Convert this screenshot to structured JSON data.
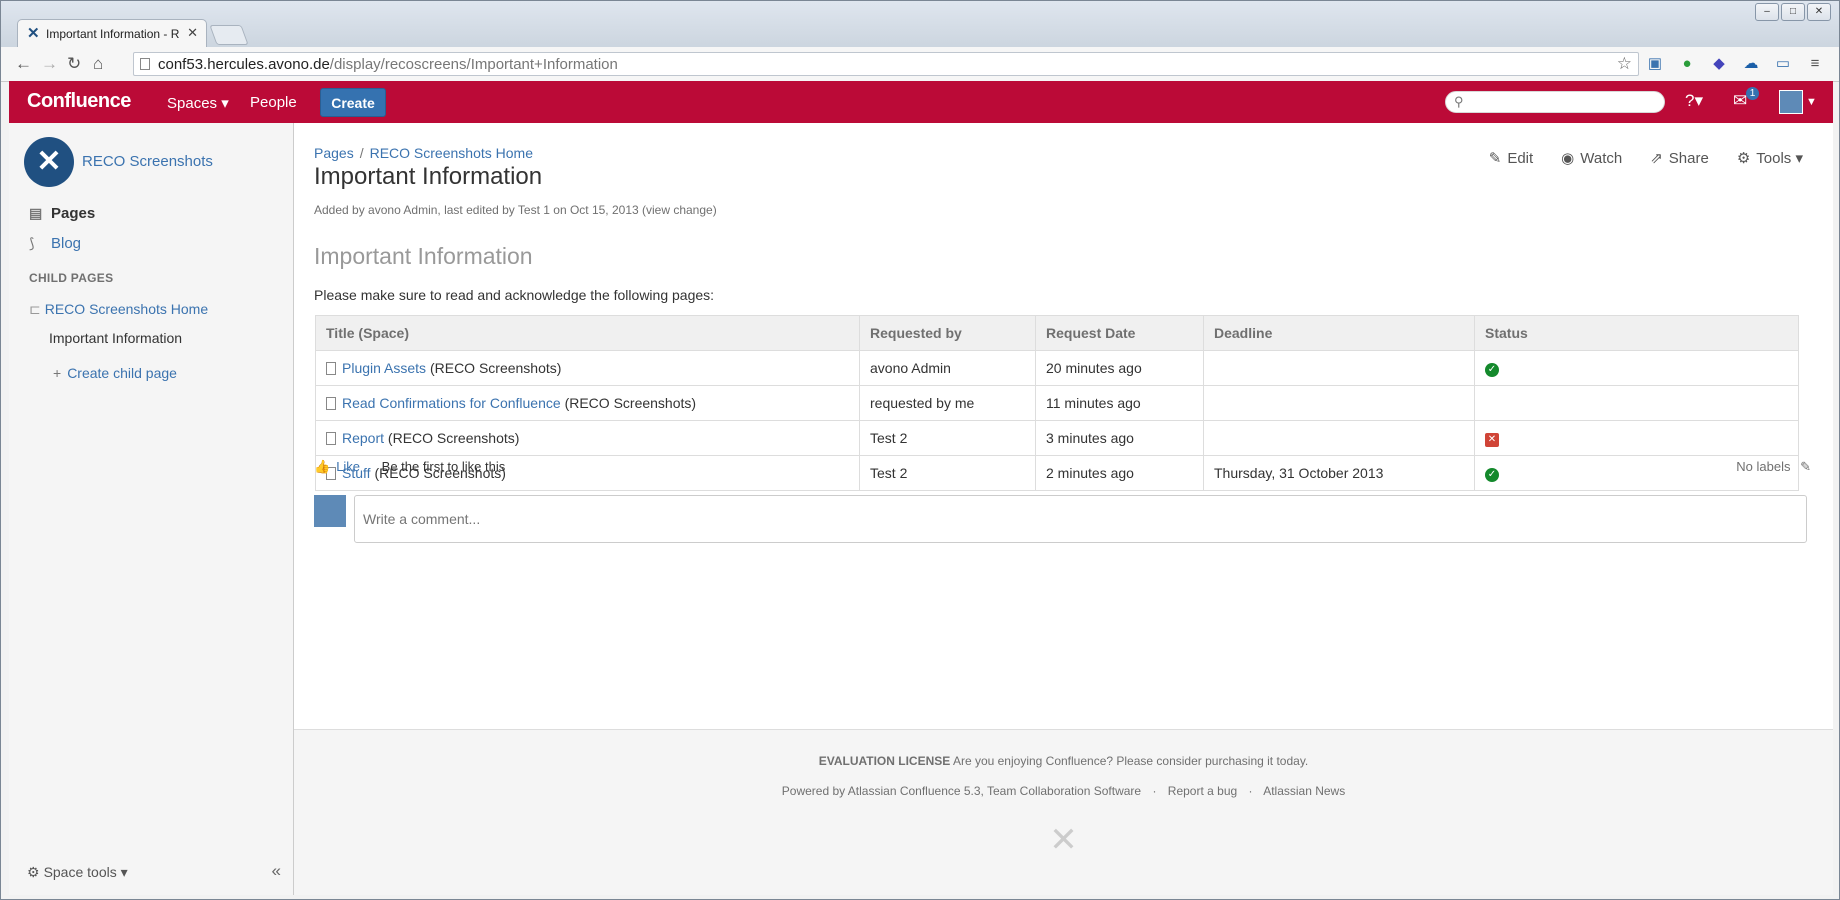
{
  "browser": {
    "tab_title": "Important Information - R",
    "url_host": "conf53.hercules.avono.de",
    "url_path": "/display/recoscreens/Important+Information"
  },
  "header": {
    "logo": "Confluence",
    "spaces_label": "Spaces ▾",
    "people_label": "People",
    "create_label": "Create",
    "notification_count": "1"
  },
  "sidebar": {
    "space_name": "RECO Screenshots",
    "pages_label": "Pages",
    "blog_label": "Blog",
    "child_pages_heading": "CHILD PAGES",
    "tree": [
      "RECO Screenshots Home",
      "Important Information"
    ],
    "create_child": "Create child page",
    "space_tools": "Space tools ▾"
  },
  "page": {
    "breadcrumb": [
      "Pages",
      "RECO Screenshots Home"
    ],
    "title": "Important Information",
    "byline": "Added by avono Admin, last edited by Test 1 on Oct 15, 2013  (view change)",
    "actions": {
      "edit": "Edit",
      "watch": "Watch",
      "share": "Share",
      "tools": "Tools ▾"
    },
    "section_title": "Important Information",
    "intro": "Please make sure to read and acknowledge the following pages:",
    "table": {
      "headers": [
        "Title (Space)",
        "Requested by",
        "Request Date",
        "Deadline",
        "Status"
      ],
      "rows": [
        {
          "title": "Plugin Assets",
          "space": "(RECO Screenshots)",
          "requested_by": "avono Admin",
          "date": "20 minutes ago",
          "deadline": "",
          "status": "ok"
        },
        {
          "title": "Read Confirmations for Confluence",
          "space": "(RECO Screenshots)",
          "requested_by": "requested by me",
          "date": "11 minutes ago",
          "deadline": "",
          "status": ""
        },
        {
          "title": "Report",
          "space": "(RECO Screenshots)",
          "requested_by": "Test 2",
          "date": "3 minutes ago",
          "deadline": "",
          "status": "no"
        },
        {
          "title": "Stuff",
          "space": "(RECO Screenshots)",
          "requested_by": "Test 2",
          "date": "2 minutes ago",
          "deadline": "Thursday, 31 October 2013",
          "status": "ok"
        }
      ]
    },
    "like_label": "Like",
    "like_text": "Be the first to like this",
    "labels_text": "No labels",
    "comment_placeholder": "Write a comment..."
  },
  "footer": {
    "license_bold": "EVALUATION LICENSE",
    "license_text": " Are you enjoying Confluence? Please consider purchasing it today.",
    "powered": "Powered by Atlassian Confluence 5.3, Team Collaboration Software",
    "report_bug": "Report a bug",
    "news": "Atlassian News"
  },
  "colors": {
    "header": "#bb0a37",
    "link": "#3b73af",
    "create": "#3572b0",
    "ok": "#14892c",
    "error": "#d04437"
  }
}
